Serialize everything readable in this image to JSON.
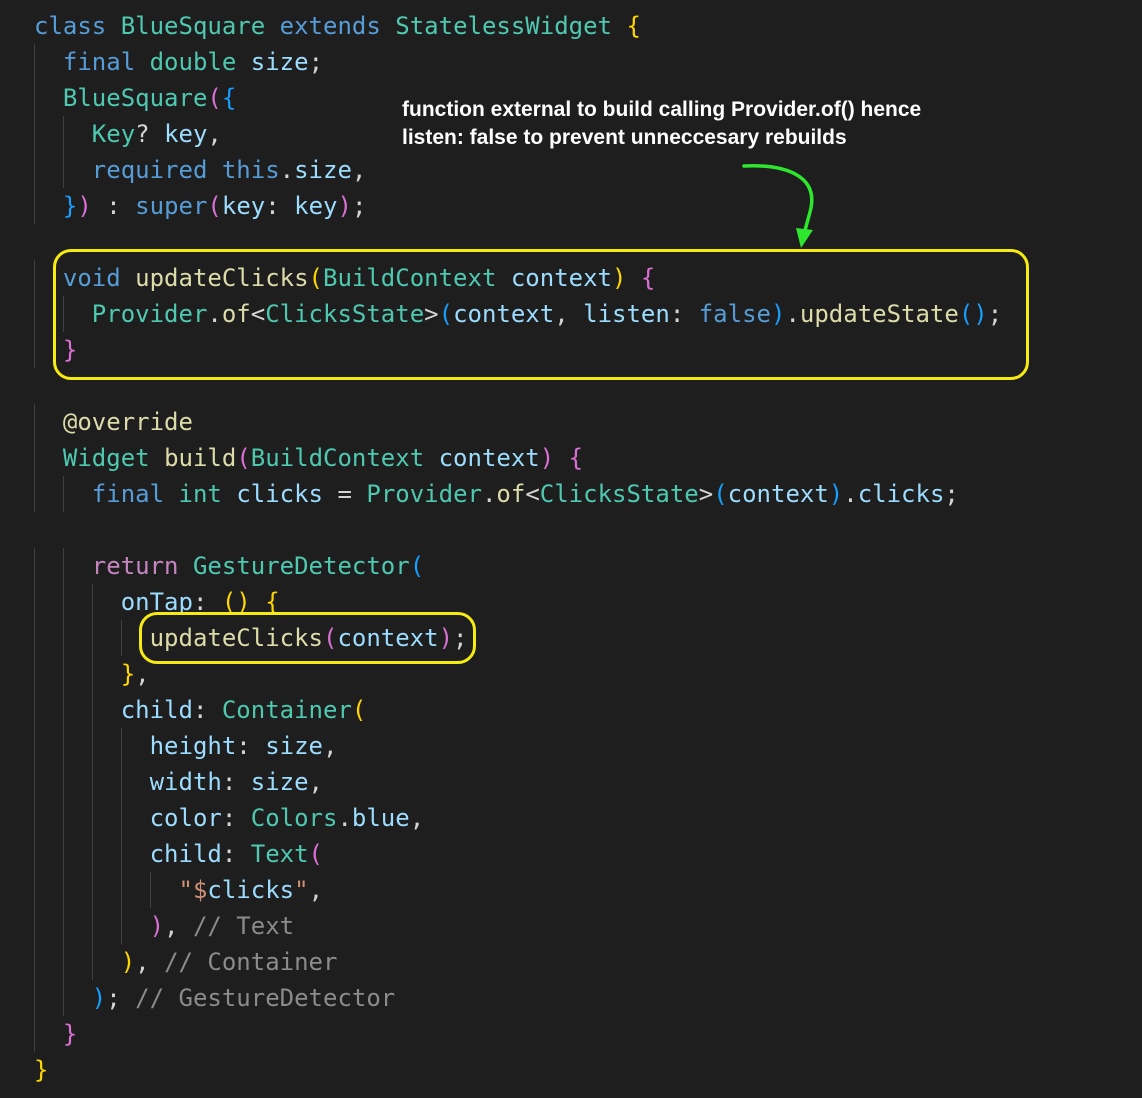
{
  "colors": {
    "background": "#1e1e1e",
    "keyword_blue": "#569cd6",
    "control_pink": "#c586c0",
    "type_teal": "#4ec9b0",
    "function_yellow": "#dcdcaa",
    "variable_blue": "#9cdcfe",
    "string_orange": "#ce9178",
    "comment_gray": "#8b8b8b",
    "bracket_gold": "#ffd700",
    "bracket_purple": "#da70d6",
    "bracket_blue": "#179fff",
    "highlight_yellow": "#f5ea12",
    "arrow_green": "#2ee62e",
    "annotation_white": "#ffffff"
  },
  "annotation": {
    "line1": "function external to build calling Provider.of() hence",
    "line2": "listen: false to prevent unneccesary rebuilds"
  },
  "icons": [
    "green-curved-arrow-icon"
  ],
  "code_lines": [
    [
      [
        "class",
        "kw"
      ],
      [
        " ",
        "p"
      ],
      [
        "BlueSquare",
        "ty"
      ],
      [
        " ",
        "p"
      ],
      [
        "extends",
        "kw"
      ],
      [
        " ",
        "p"
      ],
      [
        "StatelessWidget",
        "ty"
      ],
      [
        " ",
        "p"
      ],
      [
        "{",
        "b1"
      ]
    ],
    [
      [
        "  ",
        "p"
      ],
      [
        "final",
        "kw"
      ],
      [
        " ",
        "p"
      ],
      [
        "double",
        "ty"
      ],
      [
        " ",
        "p"
      ],
      [
        "size",
        "va"
      ],
      [
        ";",
        "p"
      ]
    ],
    [
      [
        "  ",
        "p"
      ],
      [
        "BlueSquare",
        "ty"
      ],
      [
        "(",
        "b2"
      ],
      [
        "{",
        "b3"
      ]
    ],
    [
      [
        "    ",
        "p"
      ],
      [
        "Key",
        "ty"
      ],
      [
        "? ",
        "p"
      ],
      [
        "key",
        "va"
      ],
      [
        ",",
        "p"
      ]
    ],
    [
      [
        "    ",
        "p"
      ],
      [
        "required",
        "kw"
      ],
      [
        " ",
        "p"
      ],
      [
        "this",
        "kw"
      ],
      [
        ".",
        "p"
      ],
      [
        "size",
        "va"
      ],
      [
        ",",
        "p"
      ]
    ],
    [
      [
        "  ",
        "p"
      ],
      [
        "}",
        "b3"
      ],
      [
        ")",
        "b2"
      ],
      [
        " : ",
        "p"
      ],
      [
        "super",
        "kw"
      ],
      [
        "(",
        "b2"
      ],
      [
        "key",
        "va"
      ],
      [
        ": ",
        "p"
      ],
      [
        "key",
        "va"
      ],
      [
        ")",
        "b2"
      ],
      [
        ";",
        "p"
      ]
    ],
    [],
    [
      [
        "  ",
        "p"
      ],
      [
        "void",
        "kw"
      ],
      [
        " ",
        "p"
      ],
      [
        "updateClicks",
        "fn"
      ],
      [
        "(",
        "b1"
      ],
      [
        "BuildContext",
        "ty"
      ],
      [
        " ",
        "p"
      ],
      [
        "context",
        "va"
      ],
      [
        ")",
        "b1"
      ],
      [
        " ",
        "p"
      ],
      [
        "{",
        "b2"
      ]
    ],
    [
      [
        "    ",
        "p"
      ],
      [
        "Provider",
        "ty"
      ],
      [
        ".",
        "p"
      ],
      [
        "of",
        "fn"
      ],
      [
        "<",
        "p"
      ],
      [
        "ClicksState",
        "ty"
      ],
      [
        ">",
        "p"
      ],
      [
        "(",
        "b3"
      ],
      [
        "context",
        "va"
      ],
      [
        ", ",
        "p"
      ],
      [
        "listen",
        "va"
      ],
      [
        ": ",
        "p"
      ],
      [
        "false",
        "kw"
      ],
      [
        ")",
        "b3"
      ],
      [
        ".",
        "p"
      ],
      [
        "updateState",
        "fn"
      ],
      [
        "(",
        "b3"
      ],
      [
        ")",
        "b3"
      ],
      [
        ";",
        "p"
      ]
    ],
    [
      [
        "  ",
        "p"
      ],
      [
        "}",
        "b2"
      ]
    ],
    [],
    [
      [
        "  ",
        "p"
      ],
      [
        "@override",
        "fn"
      ]
    ],
    [
      [
        "  ",
        "p"
      ],
      [
        "Widget",
        "ty"
      ],
      [
        " ",
        "p"
      ],
      [
        "build",
        "fn"
      ],
      [
        "(",
        "b2"
      ],
      [
        "BuildContext",
        "ty"
      ],
      [
        " ",
        "p"
      ],
      [
        "context",
        "va"
      ],
      [
        ")",
        "b2"
      ],
      [
        " ",
        "p"
      ],
      [
        "{",
        "b2"
      ]
    ],
    [
      [
        "    ",
        "p"
      ],
      [
        "final",
        "kw"
      ],
      [
        " ",
        "p"
      ],
      [
        "int",
        "ty"
      ],
      [
        " ",
        "p"
      ],
      [
        "clicks",
        "va"
      ],
      [
        " = ",
        "p"
      ],
      [
        "Provider",
        "ty"
      ],
      [
        ".",
        "p"
      ],
      [
        "of",
        "fn"
      ],
      [
        "<",
        "p"
      ],
      [
        "ClicksState",
        "ty"
      ],
      [
        ">",
        "p"
      ],
      [
        "(",
        "b3"
      ],
      [
        "context",
        "va"
      ],
      [
        ")",
        "b3"
      ],
      [
        ".",
        "p"
      ],
      [
        "clicks",
        "va"
      ],
      [
        ";",
        "p"
      ]
    ],
    [],
    [
      [
        "    ",
        "p"
      ],
      [
        "return",
        "ct"
      ],
      [
        " ",
        "p"
      ],
      [
        "GestureDetector",
        "ty"
      ],
      [
        "(",
        "b3"
      ]
    ],
    [
      [
        "      ",
        "p"
      ],
      [
        "onTap",
        "va"
      ],
      [
        ": ",
        "p"
      ],
      [
        "()",
        "b1"
      ],
      [
        " ",
        "p"
      ],
      [
        "{",
        "b1"
      ]
    ],
    [
      [
        "        ",
        "p"
      ],
      [
        "updateClicks",
        "fn"
      ],
      [
        "(",
        "b2"
      ],
      [
        "context",
        "va"
      ],
      [
        ")",
        "b2"
      ],
      [
        ";",
        "p"
      ]
    ],
    [
      [
        "      ",
        "p"
      ],
      [
        "}",
        "b1"
      ],
      [
        ",",
        "p"
      ]
    ],
    [
      [
        "      ",
        "p"
      ],
      [
        "child",
        "va"
      ],
      [
        ": ",
        "p"
      ],
      [
        "Container",
        "ty"
      ],
      [
        "(",
        "b1"
      ]
    ],
    [
      [
        "        ",
        "p"
      ],
      [
        "height",
        "va"
      ],
      [
        ": ",
        "p"
      ],
      [
        "size",
        "va"
      ],
      [
        ",",
        "p"
      ]
    ],
    [
      [
        "        ",
        "p"
      ],
      [
        "width",
        "va"
      ],
      [
        ": ",
        "p"
      ],
      [
        "size",
        "va"
      ],
      [
        ",",
        "p"
      ]
    ],
    [
      [
        "        ",
        "p"
      ],
      [
        "color",
        "va"
      ],
      [
        ": ",
        "p"
      ],
      [
        "Colors",
        "ty"
      ],
      [
        ".",
        "p"
      ],
      [
        "blue",
        "va"
      ],
      [
        ",",
        "p"
      ]
    ],
    [
      [
        "        ",
        "p"
      ],
      [
        "child",
        "va"
      ],
      [
        ": ",
        "p"
      ],
      [
        "Text",
        "ty"
      ],
      [
        "(",
        "b2"
      ]
    ],
    [
      [
        "          ",
        "p"
      ],
      [
        "\"$",
        "st"
      ],
      [
        "clicks",
        "va"
      ],
      [
        "\"",
        "st"
      ],
      [
        ",",
        "p"
      ]
    ],
    [
      [
        "        ",
        "p"
      ],
      [
        ")",
        "b2"
      ],
      [
        ", ",
        "p"
      ],
      [
        "// Text",
        "cm"
      ]
    ],
    [
      [
        "      ",
        "p"
      ],
      [
        ")",
        "b1"
      ],
      [
        ", ",
        "p"
      ],
      [
        "// Container",
        "cm"
      ]
    ],
    [
      [
        "    ",
        "p"
      ],
      [
        ")",
        "b3"
      ],
      [
        "; ",
        "p"
      ],
      [
        "// GestureDetector",
        "cm"
      ]
    ],
    [
      [
        "  ",
        "p"
      ],
      [
        "}",
        "b2"
      ]
    ],
    [
      [
        "}",
        "b1"
      ]
    ]
  ]
}
